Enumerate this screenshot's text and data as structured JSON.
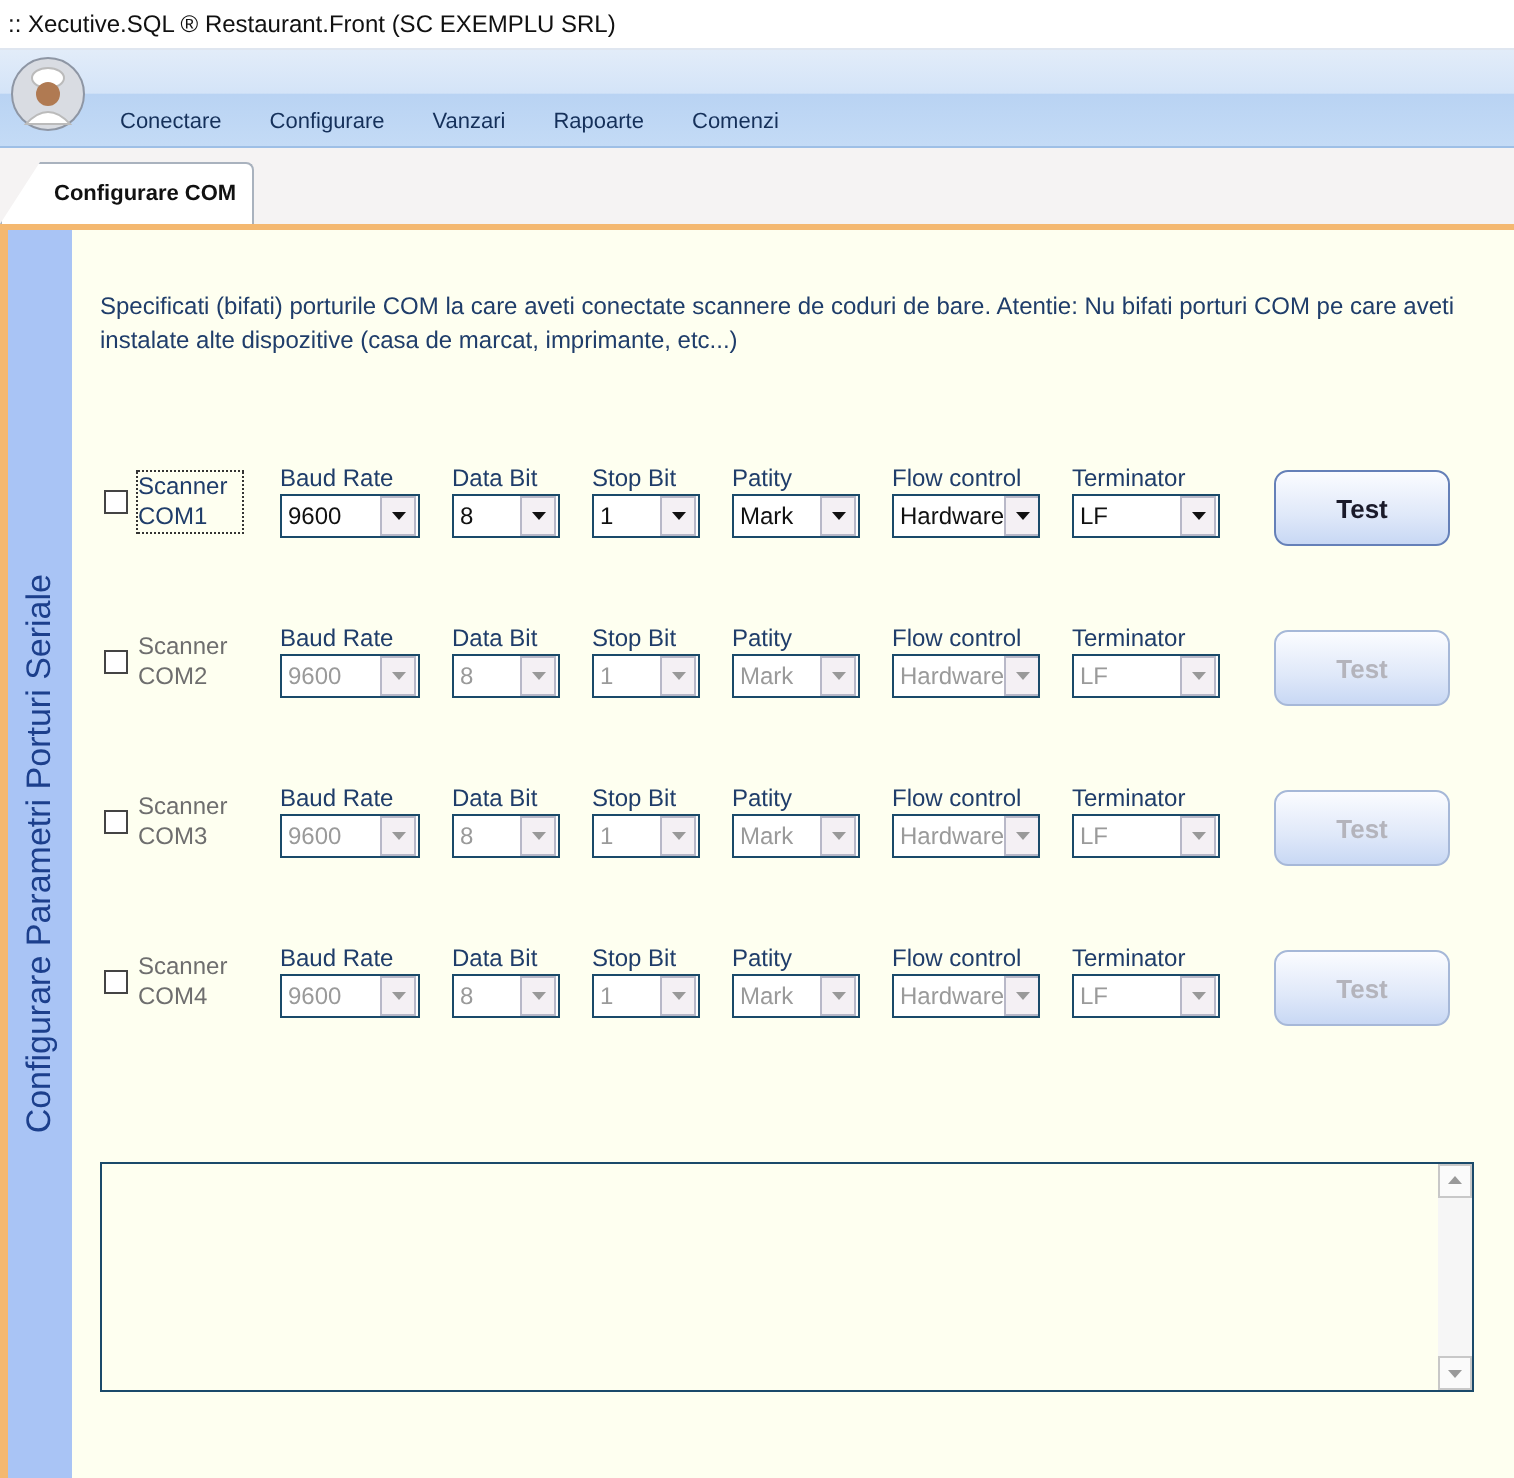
{
  "window": {
    "title": ":: Xecutive.SQL ® Restaurant.Front (SC EXEMPLU SRL)"
  },
  "menu": [
    {
      "label": "Conectare"
    },
    {
      "label": "Configurare"
    },
    {
      "label": "Vanzari"
    },
    {
      "label": "Rapoarte"
    },
    {
      "label": "Comenzi"
    }
  ],
  "tabs": [
    {
      "label": "Configurare COM",
      "selected": true
    }
  ],
  "side_panel": {
    "title": "Configurare Parametri Porturi Seriale"
  },
  "instructions": "Specificati (bifati) porturile COM la care aveti conectate scannere de coduri de bare. Atentie: Nu bifati porturi COM pe care aveti instalate alte dispozitive (casa de marcat, imprimante, etc...)",
  "ports": [
    {
      "name": "Scanner COM1",
      "checked": false,
      "disabled": false,
      "focused": true,
      "fields": [
        {
          "label": "Baud Rate",
          "value": "9600"
        },
        {
          "label": "Data Bit",
          "value": "8"
        },
        {
          "label": "Stop Bit",
          "value": "1"
        },
        {
          "label": "Patity",
          "value": "Mark"
        },
        {
          "label": "Flow control",
          "value": "Hardware"
        },
        {
          "label": "Terminator",
          "value": "LF"
        }
      ],
      "button": "Test"
    },
    {
      "name": "Scanner COM2",
      "checked": false,
      "disabled": true,
      "focused": false,
      "fields": [
        {
          "label": "Baud Rate",
          "value": "9600"
        },
        {
          "label": "Data Bit",
          "value": "8"
        },
        {
          "label": "Stop Bit",
          "value": "1"
        },
        {
          "label": "Patity",
          "value": "Mark"
        },
        {
          "label": "Flow control",
          "value": "Hardware"
        },
        {
          "label": "Terminator",
          "value": "LF"
        }
      ],
      "button": "Test"
    },
    {
      "name": "Scanner COM3",
      "checked": false,
      "disabled": true,
      "focused": false,
      "fields": [
        {
          "label": "Baud Rate",
          "value": "9600"
        },
        {
          "label": "Data Bit",
          "value": "8"
        },
        {
          "label": "Stop Bit",
          "value": "1"
        },
        {
          "label": "Patity",
          "value": "Mark"
        },
        {
          "label": "Flow control",
          "value": "Hardware"
        },
        {
          "label": "Terminator",
          "value": "LF"
        }
      ],
      "button": "Test"
    },
    {
      "name": "Scanner COM4",
      "checked": false,
      "disabled": true,
      "focused": false,
      "fields": [
        {
          "label": "Baud Rate",
          "value": "9600"
        },
        {
          "label": "Data Bit",
          "value": "8"
        },
        {
          "label": "Stop Bit",
          "value": "1"
        },
        {
          "label": "Patity",
          "value": "Mark"
        },
        {
          "label": "Flow control",
          "value": "Hardware"
        },
        {
          "label": "Terminator",
          "value": "LF"
        }
      ],
      "button": "Test"
    }
  ]
}
